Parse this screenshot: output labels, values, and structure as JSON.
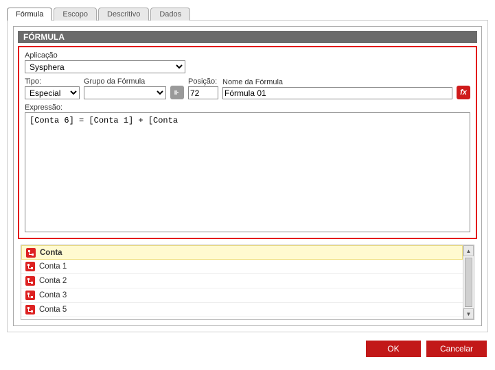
{
  "tabs": {
    "formula": "Fórmula",
    "escopo": "Escopo",
    "descritivo": "Descritivo",
    "dados": "Dados"
  },
  "header": {
    "title": "FÓRMULA"
  },
  "labels": {
    "aplicacao": "Aplicação",
    "tipo": "Tipo:",
    "grupo": "Grupo da Fórmula",
    "posicao": "Posição:",
    "nome": "Nome da Fórmula",
    "expressao": "Expressão:"
  },
  "values": {
    "aplicacao": "Sysphera",
    "tipo": "Especial",
    "grupo": "",
    "posicao": "72",
    "nome": "Fórmula 01",
    "expressao": "[Conta 6] = [Conta 1] + [Conta "
  },
  "list": [
    {
      "label": "Conta",
      "selected": true
    },
    {
      "label": "Conta 1",
      "selected": false
    },
    {
      "label": "Conta 2",
      "selected": false
    },
    {
      "label": "Conta 3",
      "selected": false
    },
    {
      "label": "Conta 5",
      "selected": false
    }
  ],
  "buttons": {
    "ok": "OK",
    "cancel": "Cancelar"
  }
}
